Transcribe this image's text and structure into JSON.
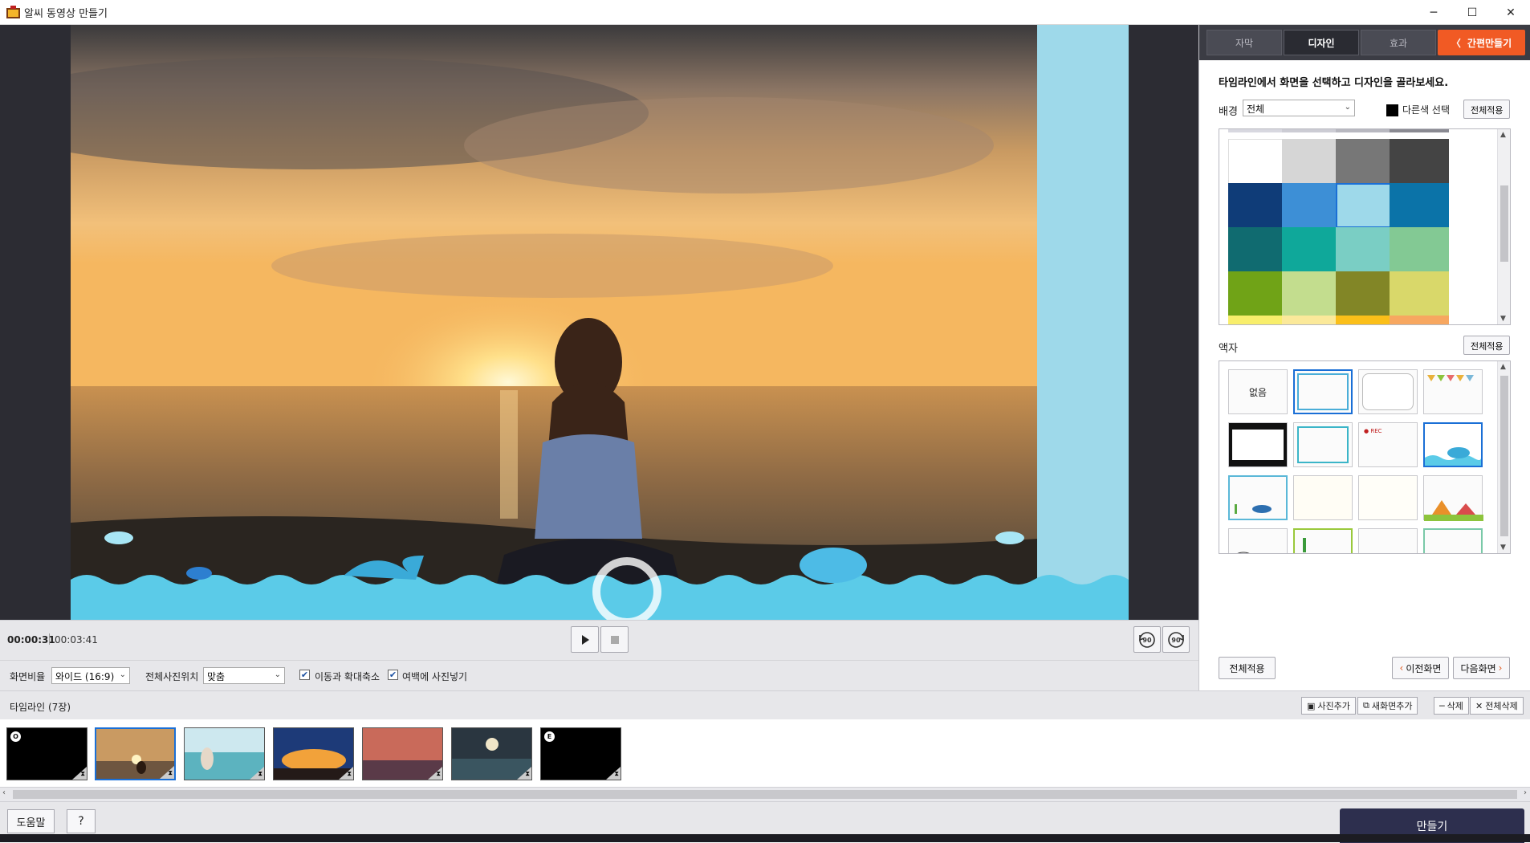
{
  "window": {
    "title": "알씨 동영상 만들기",
    "controls": {
      "minimize": "─",
      "maximize": "☐",
      "close": "✕"
    }
  },
  "playback": {
    "current_time": "00:00:31",
    "total_time": "00:03:41",
    "play_icon": "play-icon",
    "stop_icon": "stop-icon",
    "rotate_left_label": "90",
    "rotate_right_label": "90"
  },
  "options": {
    "aspect_label": "화면비율",
    "aspect_value": "와이드 (16:9)",
    "position_label": "전체사진위치",
    "position_value": "맞춤",
    "zoom_label": "이동과 확대축소",
    "zoom_checked": true,
    "fill_label": "여백에 사진넣기",
    "fill_checked": true
  },
  "panel": {
    "tabs": [
      {
        "label": "자막",
        "active": false
      },
      {
        "label": "디자인",
        "active": true
      },
      {
        "label": "효과",
        "active": false
      }
    ],
    "simple_make_label": "간편만들기",
    "instruction": "타임라인에서 화면을 선택하고 디자인을 골라보세요.",
    "background_label": "배경",
    "background_filter": "전체",
    "other_color_label": "다른색 선택",
    "apply_all_label": "전체적용",
    "background_swatches": [
      "#ffffff",
      "#d6d6d6",
      "#777777",
      "#444444",
      "#0f3c78",
      "#3d8fd6",
      "#9ed9ea",
      "#0b73a8",
      "#106b70",
      "#0fa89a",
      "#7acec4",
      "#83c994",
      "#70a317",
      "#c3dd8e",
      "#828626",
      "#d9d86a",
      "#f8ee6b",
      "#fbe99a",
      "#fbbf19",
      "#f7a760"
    ],
    "selected_swatch_index": 6,
    "frame_label": "액자",
    "frame_apply_all_label": "전체적용",
    "frame_none_label": "없음",
    "frame_rec_label": "● REC",
    "bottom_apply_all_label": "전체적용",
    "prev_screen_label": "이전화면",
    "next_screen_label": "다음화면"
  },
  "timeline": {
    "title": "타임라인 (7장)",
    "buttons": {
      "add_photo": "사진추가",
      "add_screen": "새화면추가",
      "delete": "삭제",
      "delete_all": "전체삭제"
    },
    "items": [
      {
        "badge": "O",
        "kind": "opening"
      },
      {
        "badge": "",
        "kind": "sunset-meditation"
      },
      {
        "badge": "",
        "kind": "beach-yoga"
      },
      {
        "badge": "",
        "kind": "dramatic-sunset"
      },
      {
        "badge": "",
        "kind": "red-sky"
      },
      {
        "badge": "",
        "kind": "moon-sea"
      },
      {
        "badge": "E",
        "kind": "ending"
      }
    ],
    "selected_index": 1
  },
  "footer": {
    "help_label": "도움말",
    "question_label": "?",
    "make_label": "만들기"
  }
}
